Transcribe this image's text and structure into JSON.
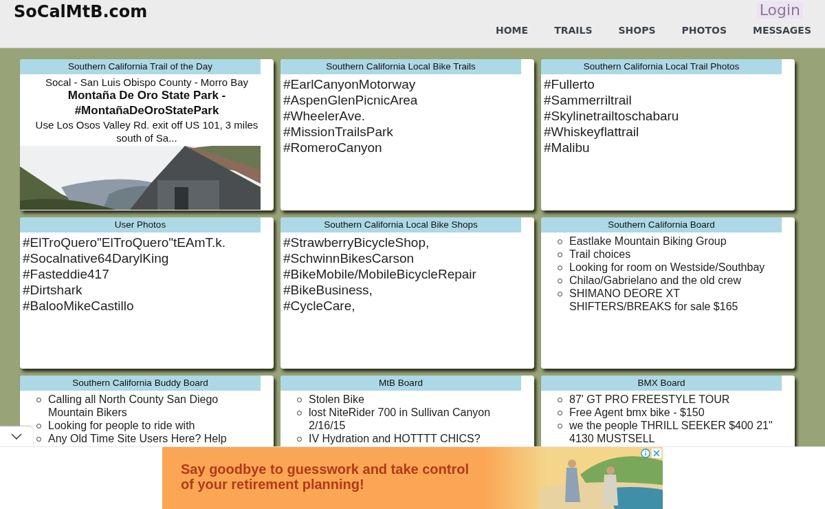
{
  "site_title": "SoCalMtB.com",
  "login": "Login",
  "nav": [
    {
      "label": "HOME"
    },
    {
      "label": "TRAILS"
    },
    {
      "label": "SHOPS"
    },
    {
      "label": "PHOTOS"
    },
    {
      "label": "MESSAGES"
    }
  ],
  "cards": [
    {
      "kind": "trail",
      "title": "Southern California Trail of the Day",
      "location": "Socal - San Luis Obispo County - Morro Bay",
      "name": "Montaña De Oro State Park - #MontañaDeOroStatePark",
      "description": "Use Los Osos Valley Rd. exit off US 101, 3 miles south of Sa..."
    },
    {
      "kind": "tags",
      "title": "Southern California Local Bike Trails",
      "items": [
        "#EarlCanyonMotorway",
        "#AspenGlenPicnicArea",
        "#WheelerAve.",
        "#MissionTrailsPark",
        "#RomeroCanyon"
      ]
    },
    {
      "kind": "tags",
      "title": "Southern California Local Trail Photos",
      "items": [
        "#Fullerto",
        "#Sammerriltrail",
        "#Skylinetrailtoschabaru",
        "#Whiskeyflattrail",
        "#Malibu"
      ]
    },
    {
      "kind": "tags",
      "title": "User Photos",
      "items": [
        "#ElTroQuero\"ElTroQuero\"tEAmT.k.",
        "#Socalnative64DarylKing",
        "#Fasteddie417",
        "#Dirtshark",
        "#BalooMikeCastillo"
      ]
    },
    {
      "kind": "tags",
      "title": "Southern California Local Bike Shops",
      "items": [
        "#StrawberryBicycleShop,",
        "#SchwinnBikesCarson",
        "#BikeMobile/MobileBicycleRepair",
        "#BikeBusiness,",
        "#CycleCare,"
      ]
    },
    {
      "kind": "list",
      "title": "Southern California Board",
      "items": [
        "Eastlake Mountain Biking Group",
        "Trail choices",
        "Looking for room on Westside/Southbay",
        "Chilao/Gabrielano and the old crew",
        "SHIMANO DEORE XT SHIFTERS/BREAKS for sale $165"
      ]
    },
    {
      "kind": "list",
      "title": "Southern California Buddy Board",
      "items": [
        "Calling all North County San Diego Mountain Bikers",
        "Looking for people to ride with",
        "Any Old Time Site Users Here? Help"
      ]
    },
    {
      "kind": "list",
      "title": "MtB Board",
      "items": [
        "Stolen Bike",
        "lost NiteRider 700 in Sullivan Canyon 2/16/15",
        "IV Hydration and HOTTTT CHICS?"
      ]
    },
    {
      "kind": "list",
      "title": "BMX Board",
      "items": [
        "87' GT PRO FREESTYLE TOUR",
        "Free Agent bmx bike - $150",
        "we the people THRILL SEEKER $400 21\" 4130 MUSTSELL"
      ]
    }
  ],
  "ad": {
    "text": "Say goodbye to guesswork and take control of your retirement planning!"
  }
}
